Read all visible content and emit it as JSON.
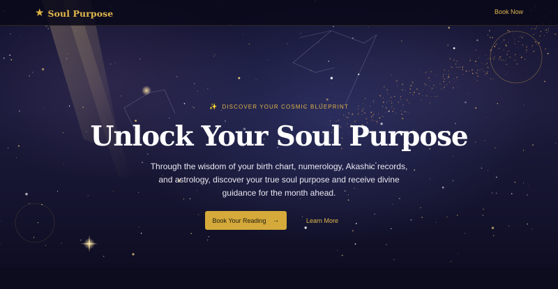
{
  "nav": {
    "brand_icon": "star-icon",
    "brand_name": "Soul Purpose",
    "book_now": "Book Now"
  },
  "hero": {
    "eyebrow_icon": "sparkles-icon",
    "eyebrow": "DISCOVER YOUR COSMIC BLUEPRINT",
    "title": "Unlock Your Soul Purpose",
    "subtitle": "Through the wisdom of your birth chart, numerology, Akashic records, and astrology, discover your true soul purpose and receive divine guidance for the month ahead.",
    "primary_button": "Book Your Reading",
    "primary_button_icon": "arrow-right-icon",
    "secondary_link": "Learn More"
  },
  "colors": {
    "gold": "#d5aa3b",
    "gold_text": "#e2b84c",
    "background": "#15142f"
  }
}
